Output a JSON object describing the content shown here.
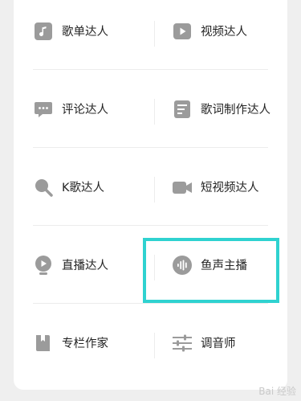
{
  "items": [
    {
      "label": "歌单达人",
      "icon": "music-note-icon"
    },
    {
      "label": "视频达人",
      "icon": "video-play-icon"
    },
    {
      "label": "评论达人",
      "icon": "comment-bubble-icon"
    },
    {
      "label": "歌词制作达人",
      "icon": "lyrics-document-icon"
    },
    {
      "label": "K歌达人",
      "icon": "microphone-icon"
    },
    {
      "label": "短视频达人",
      "icon": "video-camera-icon"
    },
    {
      "label": "直播达人",
      "icon": "live-camera-icon"
    },
    {
      "label": "鱼声主播",
      "icon": "sound-wave-icon"
    },
    {
      "label": "专栏作家",
      "icon": "book-icon"
    },
    {
      "label": "调音师",
      "icon": "equalizer-icon"
    }
  ],
  "highlight_color": "#2fd2d0",
  "watermark": "Bai 经验"
}
